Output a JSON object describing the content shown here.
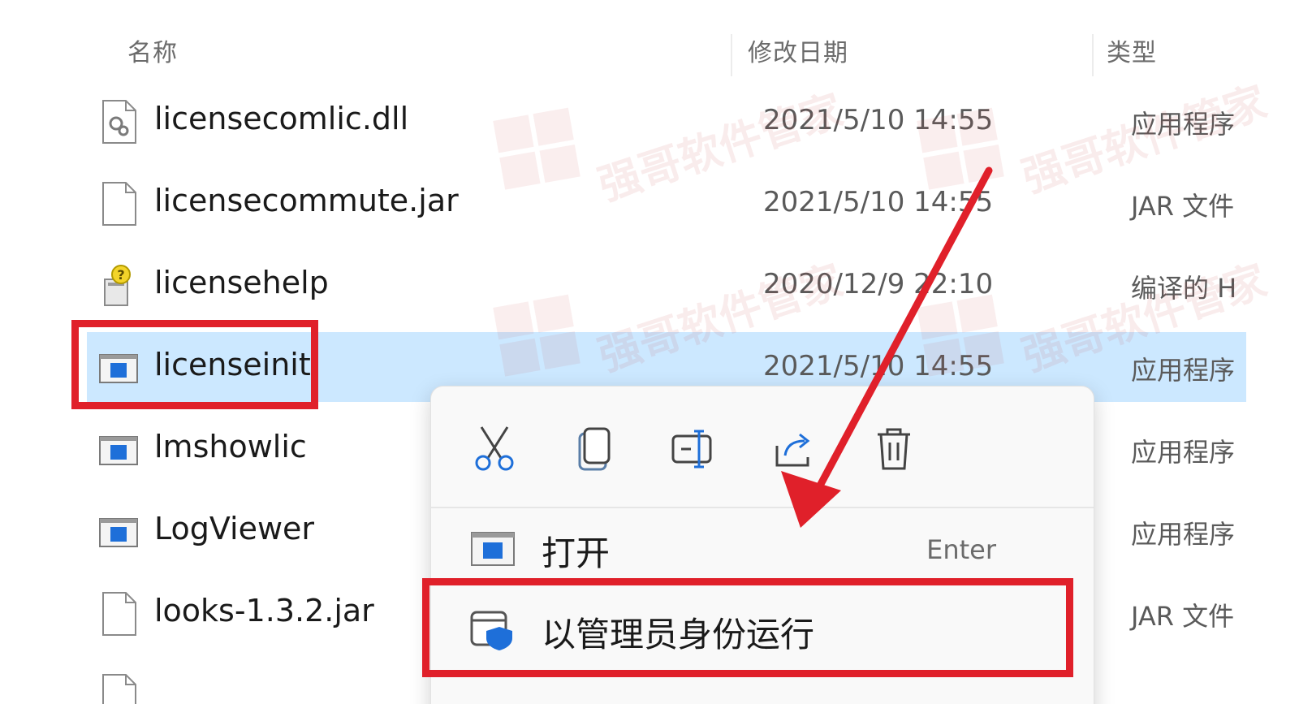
{
  "columns": {
    "name": "名称",
    "date_modified": "修改日期",
    "type": "类型"
  },
  "files": [
    {
      "name": "licensecomlic.dll",
      "date": "2021/5/10 14:55",
      "type": "应用程序",
      "icon": "dll-file-icon"
    },
    {
      "name": "licensecommute.jar",
      "date": "2021/5/10 14:55",
      "type": "JAR 文件",
      "icon": "blank-file-icon"
    },
    {
      "name": "licensehelp",
      "date": "2020/12/9 22:10",
      "type": "编译的 H",
      "icon": "help-file-icon"
    },
    {
      "name": "licenseinit",
      "date": "2021/5/10 14:55",
      "type": "应用程序",
      "icon": "application-icon",
      "selected": true
    },
    {
      "name": "lmshowlic",
      "date": "",
      "type": "应用程序",
      "icon": "application-icon"
    },
    {
      "name": "LogViewer",
      "date": "",
      "type": "应用程序",
      "icon": "application-icon"
    },
    {
      "name": "looks-1.3.2.jar",
      "date": "",
      "type": "JAR 文件",
      "icon": "blank-file-icon"
    }
  ],
  "context_menu": {
    "toolbar": [
      "cut-icon",
      "copy-icon",
      "rename-icon",
      "share-icon",
      "delete-icon"
    ],
    "items": [
      {
        "label": "打开",
        "shortcut": "Enter",
        "icon": "application-icon"
      },
      {
        "label": "以管理员身份运行",
        "shortcut": "",
        "icon": "admin-shield-icon"
      }
    ]
  },
  "watermark": "强哥软件管家",
  "colors": {
    "selection": "#cce8ff",
    "highlight": "#e0202a",
    "accent_blue": "#1e6fd9"
  }
}
